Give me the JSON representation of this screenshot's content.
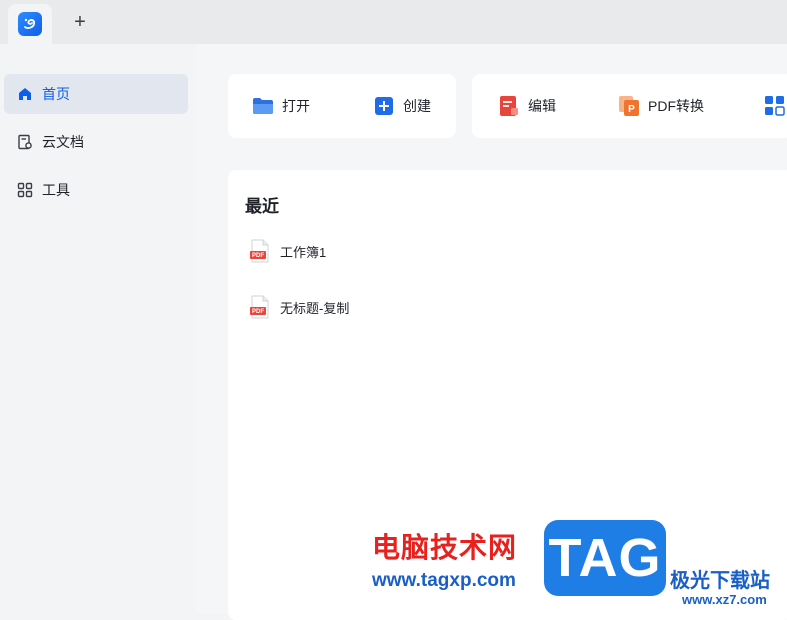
{
  "tabbar": {
    "new_tab_label": "+"
  },
  "sidebar": {
    "items": [
      {
        "label": "首页",
        "icon": "home-icon"
      },
      {
        "label": "云文档",
        "icon": "cloud-doc-icon"
      },
      {
        "label": "工具",
        "icon": "tools-grid-icon"
      }
    ]
  },
  "toolbar": {
    "open_label": "打开",
    "create_label": "创建",
    "edit_label": "编辑",
    "pdf_convert_label": "PDF转换"
  },
  "recent": {
    "title": "最近",
    "files": [
      {
        "name": "工作簿1",
        "badge": "PDF"
      },
      {
        "name": "无标题-复制",
        "badge": "PDF"
      }
    ]
  },
  "watermark": {
    "cn_text": "电脑技术网",
    "url": "www.tagxp.com",
    "tag": "TAG",
    "site_cn": "极光下载站",
    "site_url": "www.xz7.com"
  },
  "colors": {
    "accent": "#0f5ee8",
    "sidebar_active_bg": "#e1e6ef",
    "pdf_red": "#e8453c",
    "convert_orange": "#f0742e"
  }
}
